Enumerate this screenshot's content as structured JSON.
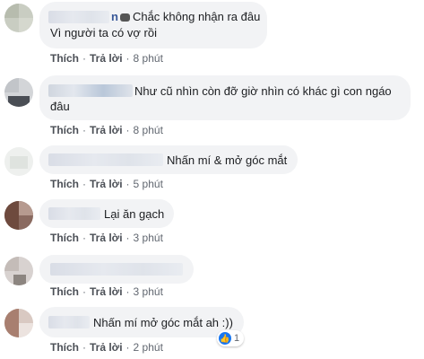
{
  "actions": {
    "like": "Thích",
    "reply": "Trả lời"
  },
  "comments": [
    {
      "text": "Chắc không nhận ra đâu",
      "text2": "Vì người ta có vợ rồi",
      "time": "8 phút",
      "name_prefix": "n"
    },
    {
      "text": "Như cũ nhìn còn đỡ giờ nhìn có khác gì con ngáo",
      "text2": "đâu",
      "time": "8 phút"
    },
    {
      "text": "Nhấn mí & mở góc mắt",
      "time": "5 phút"
    },
    {
      "text": "Lại ăn gạch",
      "time": "3 phút"
    },
    {
      "text": "",
      "time": "3 phút"
    },
    {
      "text": "Nhấn mí mở góc mắt ah :))",
      "time": "2 phút",
      "likes": "1"
    }
  ],
  "colors": {
    "bubble": "#f2f3f5",
    "like_blue": "#1877f2"
  }
}
